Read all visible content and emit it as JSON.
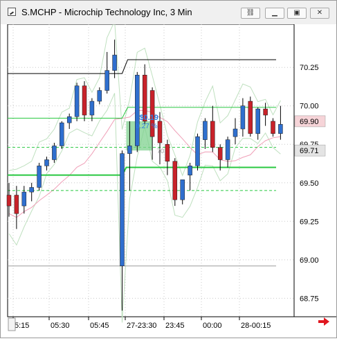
{
  "window": {
    "title": "S.MCHP - Microchip Technology Inc, 3 Min"
  },
  "titlebar_buttons": [
    {
      "name": "link-button",
      "glyph": "⛓"
    },
    {
      "name": "minimize-button",
      "glyph": "▁"
    },
    {
      "name": "restore-button",
      "glyph": "▣"
    },
    {
      "name": "close-button",
      "glyph": "✕"
    }
  ],
  "colors": {
    "up": "#2f6fce",
    "down": "#c8222a",
    "price_line": "#000000",
    "envelope": "#bfe0bf",
    "green_level": "#28c840",
    "ma": "#f0a0b8",
    "highlight": "#7fd18f"
  },
  "chart_data": {
    "type": "candlestick",
    "symbol": "S.MCHP",
    "interval": "3 Min",
    "ylim": [
      68.63,
      70.53
    ],
    "y_ticks": [
      "70.25",
      "70.00",
      "69.75",
      "69.50",
      "69.25",
      "69.00",
      "68.75"
    ],
    "x_ticks": [
      "5:15",
      "05:30",
      "05:45",
      "27-23:30",
      "23:45",
      "00:00",
      "28-00:15"
    ],
    "candles": [
      {
        "o": 69.42,
        "h": 69.5,
        "l": 69.28,
        "c": 69.35
      },
      {
        "o": 69.42,
        "h": 69.48,
        "l": 69.2,
        "c": 69.3
      },
      {
        "o": 69.35,
        "h": 69.48,
        "l": 69.3,
        "c": 69.44
      },
      {
        "o": 69.44,
        "h": 69.5,
        "l": 69.38,
        "c": 69.47
      },
      {
        "o": 69.47,
        "h": 69.63,
        "l": 69.45,
        "c": 69.61
      },
      {
        "o": 69.61,
        "h": 69.67,
        "l": 69.58,
        "c": 69.65
      },
      {
        "o": 69.65,
        "h": 69.76,
        "l": 69.63,
        "c": 69.74
      },
      {
        "o": 69.74,
        "h": 69.9,
        "l": 69.72,
        "c": 69.89
      },
      {
        "o": 69.89,
        "h": 69.95,
        "l": 69.85,
        "c": 69.93
      },
      {
        "o": 69.93,
        "h": 70.15,
        "l": 69.9,
        "c": 70.13
      },
      {
        "o": 70.13,
        "h": 70.16,
        "l": 69.9,
        "c": 69.94
      },
      {
        "o": 69.94,
        "h": 70.05,
        "l": 69.9,
        "c": 70.03
      },
      {
        "o": 70.03,
        "h": 70.12,
        "l": 70.01,
        "c": 70.1
      },
      {
        "o": 70.1,
        "h": 70.35,
        "l": 70.08,
        "c": 70.23
      },
      {
        "o": 70.23,
        "h": 70.43,
        "l": 70.18,
        "c": 70.33
      },
      {
        "o": 68.96,
        "h": 69.71,
        "l": 68.67,
        "c": 69.69
      },
      {
        "o": 69.69,
        "h": 69.9,
        "l": 69.45,
        "c": 69.74
      },
      {
        "o": 69.74,
        "h": 70.22,
        "l": 69.7,
        "c": 70.2
      },
      {
        "o": 70.2,
        "h": 70.27,
        "l": 69.88,
        "c": 69.9
      },
      {
        "o": 70.1,
        "h": 70.12,
        "l": 69.65,
        "c": 69.8
      },
      {
        "o": 69.9,
        "h": 69.96,
        "l": 69.62,
        "c": 69.76
      },
      {
        "o": 69.75,
        "h": 69.78,
        "l": 69.55,
        "c": 69.64
      },
      {
        "o": 69.64,
        "h": 69.66,
        "l": 69.35,
        "c": 69.39
      },
      {
        "o": 69.39,
        "h": 69.52,
        "l": 69.36,
        "c": 69.52
      },
      {
        "o": 69.55,
        "h": 69.63,
        "l": 69.45,
        "c": 69.61
      },
      {
        "o": 69.61,
        "h": 69.82,
        "l": 69.58,
        "c": 69.8
      },
      {
        "o": 69.78,
        "h": 69.92,
        "l": 69.72,
        "c": 69.9
      },
      {
        "o": 69.9,
        "h": 70.0,
        "l": 69.7,
        "c": 69.73
      },
      {
        "o": 69.73,
        "h": 69.75,
        "l": 69.58,
        "c": 69.65
      },
      {
        "o": 69.65,
        "h": 69.8,
        "l": 69.6,
        "c": 69.78
      },
      {
        "o": 69.8,
        "h": 69.92,
        "l": 69.75,
        "c": 69.85
      },
      {
        "o": 69.85,
        "h": 70.05,
        "l": 69.8,
        "c": 70.0
      },
      {
        "o": 70.03,
        "h": 70.06,
        "l": 69.8,
        "c": 69.82
      },
      {
        "o": 69.82,
        "h": 69.99,
        "l": 69.78,
        "c": 69.98
      },
      {
        "o": 69.98,
        "h": 70.02,
        "l": 69.87,
        "c": 69.94
      },
      {
        "o": 69.9,
        "h": 69.92,
        "l": 69.8,
        "c": 69.82
      },
      {
        "o": 69.82,
        "h": 70.0,
        "l": 69.78,
        "c": 69.88
      }
    ],
    "levels": [
      {
        "name": "prior-high-line",
        "value": 70.3,
        "color": "#000000",
        "style": "solid-step"
      },
      {
        "name": "upper-green-line",
        "value": 69.99,
        "color": "#28c840",
        "style": "solid-step"
      },
      {
        "name": "mid-green-dashed",
        "value": 69.73,
        "color": "#28c840",
        "style": "dashed"
      },
      {
        "name": "green-support-line",
        "value": 69.6,
        "color": "#28c840",
        "style": "solid-thick"
      },
      {
        "name": "lower-green-dashed",
        "value": 69.45,
        "color": "#28c840",
        "style": "dashed"
      },
      {
        "name": "grey-low-line",
        "value": 68.96,
        "color": "#9a9a9a",
        "style": "solid"
      }
    ],
    "price_labels": [
      {
        "value": "69.90",
        "y": 69.9,
        "bg": "#f6d4d8"
      },
      {
        "value": "69.71",
        "y": 69.71,
        "bg": "#e4e4e4"
      }
    ],
    "annotation": {
      "price_change": "$0.19",
      "percent_change": "0.27 %",
      "small_label": "70",
      "box_x_start": 16,
      "box_x_end": 18.5,
      "box_y_low": 69.71,
      "box_y_high": 69.9
    }
  }
}
